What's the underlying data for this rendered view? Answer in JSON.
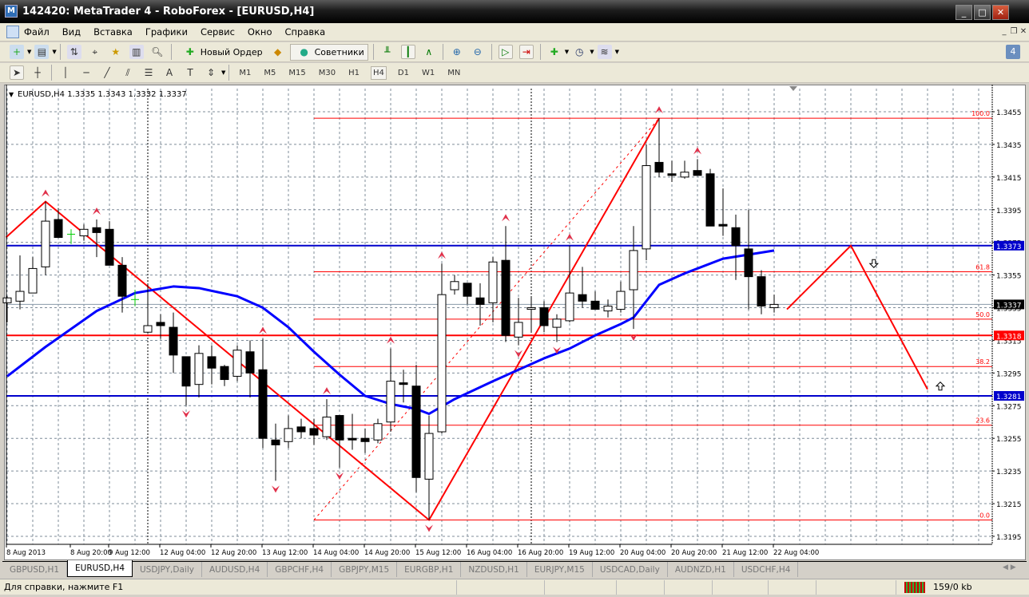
{
  "window": {
    "title": "142420: MetaTrader 4 - RoboForex - [EURUSD,H4]"
  },
  "menu": [
    "Файл",
    "Вид",
    "Вставка",
    "Графики",
    "Сервис",
    "Окно",
    "Справка"
  ],
  "toolbar": {
    "new_order": "Новый Ордер",
    "experts": "Советники",
    "badge": "4"
  },
  "timeframes": [
    "M1",
    "M5",
    "M15",
    "M30",
    "H1",
    "H4",
    "D1",
    "W1",
    "MN"
  ],
  "active_timeframe": "H4",
  "chart_data": {
    "type": "candlestick",
    "title": "EURUSD,H4  1.3335 1.3343 1.3332 1.3337",
    "symbol": "EURUSD",
    "timeframe": "H4",
    "ylim": [
      1.3185,
      1.3465
    ],
    "yticks": [
      "1.3455",
      "1.3435",
      "1.3415",
      "1.3395",
      "1.3375",
      "1.3355",
      "1.3335",
      "1.3315",
      "1.3295",
      "1.3275",
      "1.3255",
      "1.3235",
      "1.3215",
      "1.3195"
    ],
    "xticks": [
      {
        "bar": 0,
        "label": "8 Aug 2013"
      },
      {
        "bar": 5,
        "label": "8 Aug 20:00"
      },
      {
        "bar": 8,
        "label": "9 Aug 12:00"
      },
      {
        "bar": 12,
        "label": "12 Aug 04:00"
      },
      {
        "bar": 16,
        "label": "12 Aug 20:00"
      },
      {
        "bar": 20,
        "label": "13 Aug 12:00"
      },
      {
        "bar": 24,
        "label": "14 Aug 04:00"
      },
      {
        "bar": 28,
        "label": "14 Aug 20:00"
      },
      {
        "bar": 32,
        "label": "15 Aug 12:00"
      },
      {
        "bar": 36,
        "label": "16 Aug 04:00"
      },
      {
        "bar": 40,
        "label": "16 Aug 20:00"
      },
      {
        "bar": 44,
        "label": "19 Aug 12:00"
      },
      {
        "bar": 48,
        "label": "20 Aug 04:00"
      },
      {
        "bar": 52,
        "label": "20 Aug 20:00"
      },
      {
        "bar": 56,
        "label": "21 Aug 12:00"
      },
      {
        "bar": 60,
        "label": "22 Aug 04:00"
      }
    ],
    "ohlc": [
      [
        1.3338,
        1.3342,
        1.3326,
        1.3341
      ],
      [
        1.3339,
        1.3367,
        1.3334,
        1.3345
      ],
      [
        1.3344,
        1.3366,
        1.3344,
        1.3359
      ],
      [
        1.336,
        1.34,
        1.3355,
        1.3388
      ],
      [
        1.3389,
        1.3396,
        1.3378,
        1.3378
      ],
      [
        1.338,
        1.3383,
        1.3374,
        1.338
      ],
      [
        1.3379,
        1.3386,
        1.3376,
        1.3383
      ],
      [
        1.3384,
        1.3389,
        1.3366,
        1.3381
      ],
      [
        1.3383,
        1.3388,
        1.3361,
        1.3361
      ],
      [
        1.3361,
        1.3366,
        1.3332,
        1.3342
      ],
      [
        1.334,
        1.3346,
        1.3336,
        1.334
      ],
      [
        1.332,
        1.3349,
        1.3319,
        1.3324
      ],
      [
        1.3326,
        1.3331,
        1.3316,
        1.3324
      ],
      [
        1.3323,
        1.3332,
        1.3295,
        1.3306
      ],
      [
        1.3305,
        1.3305,
        1.3275,
        1.3287
      ],
      [
        1.3288,
        1.3312,
        1.328,
        1.3307
      ],
      [
        1.3305,
        1.3312,
        1.3288,
        1.3298
      ],
      [
        1.3299,
        1.33,
        1.3287,
        1.3291
      ],
      [
        1.3293,
        1.3312,
        1.329,
        1.3309
      ],
      [
        1.3308,
        1.3315,
        1.328,
        1.3295
      ],
      [
        1.3297,
        1.3316,
        1.3249,
        1.3255
      ],
      [
        1.3254,
        1.3264,
        1.3229,
        1.3251
      ],
      [
        1.3253,
        1.3269,
        1.3249,
        1.3261
      ],
      [
        1.3262,
        1.3267,
        1.3255,
        1.3259
      ],
      [
        1.3261,
        1.3267,
        1.3251,
        1.3257
      ],
      [
        1.3256,
        1.3279,
        1.3254,
        1.3268
      ],
      [
        1.3269,
        1.3269,
        1.3237,
        1.3254
      ],
      [
        1.3255,
        1.327,
        1.3248,
        1.3254
      ],
      [
        1.3255,
        1.3261,
        1.3246,
        1.3253
      ],
      [
        1.3254,
        1.3267,
        1.3252,
        1.3264
      ],
      [
        1.3265,
        1.331,
        1.3259,
        1.329
      ],
      [
        1.3289,
        1.3297,
        1.3277,
        1.3288
      ],
      [
        1.3287,
        1.33,
        1.3222,
        1.3231
      ],
      [
        1.323,
        1.3269,
        1.3205,
        1.3258
      ],
      [
        1.3259,
        1.3362,
        1.3258,
        1.3343
      ],
      [
        1.3346,
        1.3355,
        1.3343,
        1.3351
      ],
      [
        1.335,
        1.335,
        1.3337,
        1.3342
      ],
      [
        1.3341,
        1.335,
        1.3324,
        1.3337
      ],
      [
        1.3338,
        1.3366,
        1.3326,
        1.3363
      ],
      [
        1.3364,
        1.3385,
        1.3314,
        1.3318
      ],
      [
        1.3317,
        1.3341,
        1.3312,
        1.3326
      ],
      [
        1.3334,
        1.3342,
        1.332,
        1.3335
      ],
      [
        1.3335,
        1.3339,
        1.332,
        1.3324
      ],
      [
        1.3323,
        1.3331,
        1.3314,
        1.3328
      ],
      [
        1.3327,
        1.3373,
        1.3326,
        1.3344
      ],
      [
        1.3343,
        1.336,
        1.3335,
        1.3339
      ],
      [
        1.3339,
        1.3345,
        1.3334,
        1.3334
      ],
      [
        1.3333,
        1.334,
        1.3329,
        1.3336
      ],
      [
        1.3334,
        1.3351,
        1.3332,
        1.3345
      ],
      [
        1.3346,
        1.3385,
        1.3322,
        1.337
      ],
      [
        1.3371,
        1.3435,
        1.3364,
        1.3422
      ],
      [
        1.3424,
        1.3451,
        1.3415,
        1.3418
      ],
      [
        1.3417,
        1.3425,
        1.3412,
        1.3416
      ],
      [
        1.3415,
        1.3425,
        1.3414,
        1.3418
      ],
      [
        1.3419,
        1.3426,
        1.3416,
        1.3416
      ],
      [
        1.3417,
        1.342,
        1.3385,
        1.3385
      ],
      [
        1.3386,
        1.3408,
        1.3379,
        1.3385
      ],
      [
        1.3384,
        1.3392,
        1.3352,
        1.3373
      ],
      [
        1.3371,
        1.3395,
        1.3334,
        1.3354
      ],
      [
        1.3354,
        1.3358,
        1.3331,
        1.3336
      ],
      [
        1.3335,
        1.3343,
        1.3332,
        1.3337
      ]
    ],
    "moving_average": [
      [
        0,
        1.3293
      ],
      [
        3,
        1.3311
      ],
      [
        7,
        1.3333
      ],
      [
        10,
        1.3344
      ],
      [
        13,
        1.3348
      ],
      [
        15,
        1.3347
      ],
      [
        18,
        1.3342
      ],
      [
        20,
        1.3335
      ],
      [
        22,
        1.3323
      ],
      [
        24,
        1.3308
      ],
      [
        26,
        1.3294
      ],
      [
        28,
        1.3281
      ],
      [
        30,
        1.3276
      ],
      [
        32,
        1.3273
      ],
      [
        33,
        1.327
      ],
      [
        35,
        1.3279
      ],
      [
        38,
        1.329
      ],
      [
        40,
        1.3297
      ],
      [
        42,
        1.3304
      ],
      [
        44,
        1.331
      ],
      [
        46,
        1.3318
      ],
      [
        48,
        1.3325
      ],
      [
        49,
        1.3329
      ],
      [
        50,
        1.3339
      ],
      [
        51,
        1.3349
      ],
      [
        53,
        1.3356
      ],
      [
        56,
        1.3365
      ],
      [
        60,
        1.337
      ]
    ],
    "ma_color": "#0000ff",
    "hlines": [
      {
        "price": "1.3373",
        "color": "#0000cc"
      },
      {
        "price": "1.3318",
        "color": "#ff0000"
      },
      {
        "price": "1.3281",
        "color": "#0000cc"
      }
    ],
    "current_price": "1.3337",
    "fibonacci": {
      "from_bar": 24,
      "low": 1.3205,
      "high": 1.3451,
      "levels": [
        "100.0",
        "61.8",
        "50.0",
        "38.2",
        "23.6",
        "0.0"
      ],
      "color": "#ff0000"
    },
    "zigzag": [
      [
        -0.1,
        1.3378
      ],
      [
        3,
        1.34
      ],
      [
        33,
        1.3205
      ],
      [
        51,
        1.3451
      ]
    ],
    "projection": [
      [
        61,
        1.3334
      ],
      [
        66,
        1.3373
      ],
      [
        72,
        1.3285
      ]
    ],
    "arrows": [
      {
        "bar": 67.8,
        "price": 1.3362,
        "dir": "down"
      },
      {
        "bar": 73,
        "price": 1.3287,
        "dir": "up"
      }
    ],
    "fractals_up": [
      3,
      7,
      20,
      25,
      30,
      34,
      39,
      44,
      51,
      54
    ],
    "fractals_down": [
      14,
      21,
      26,
      33,
      40,
      43,
      49
    ],
    "doji_color": "#00cc00",
    "separators": [
      11,
      41
    ]
  },
  "tabs": [
    "GBPUSD,H1",
    "EURUSD,H4",
    "USDJPY,Daily",
    "AUDUSD,H4",
    "GBPCHF,H4",
    "GBPJPY,M15",
    "EURGBP,H1",
    "NZDUSD,H1",
    "EURJPY,M15",
    "USDCAD,Daily",
    "AUDNZD,H1",
    "USDCHF,H4"
  ],
  "active_tab": "EURUSD,H4",
  "status": {
    "help": "Для справки, нажмите F1",
    "traffic": "159/0 kb"
  }
}
